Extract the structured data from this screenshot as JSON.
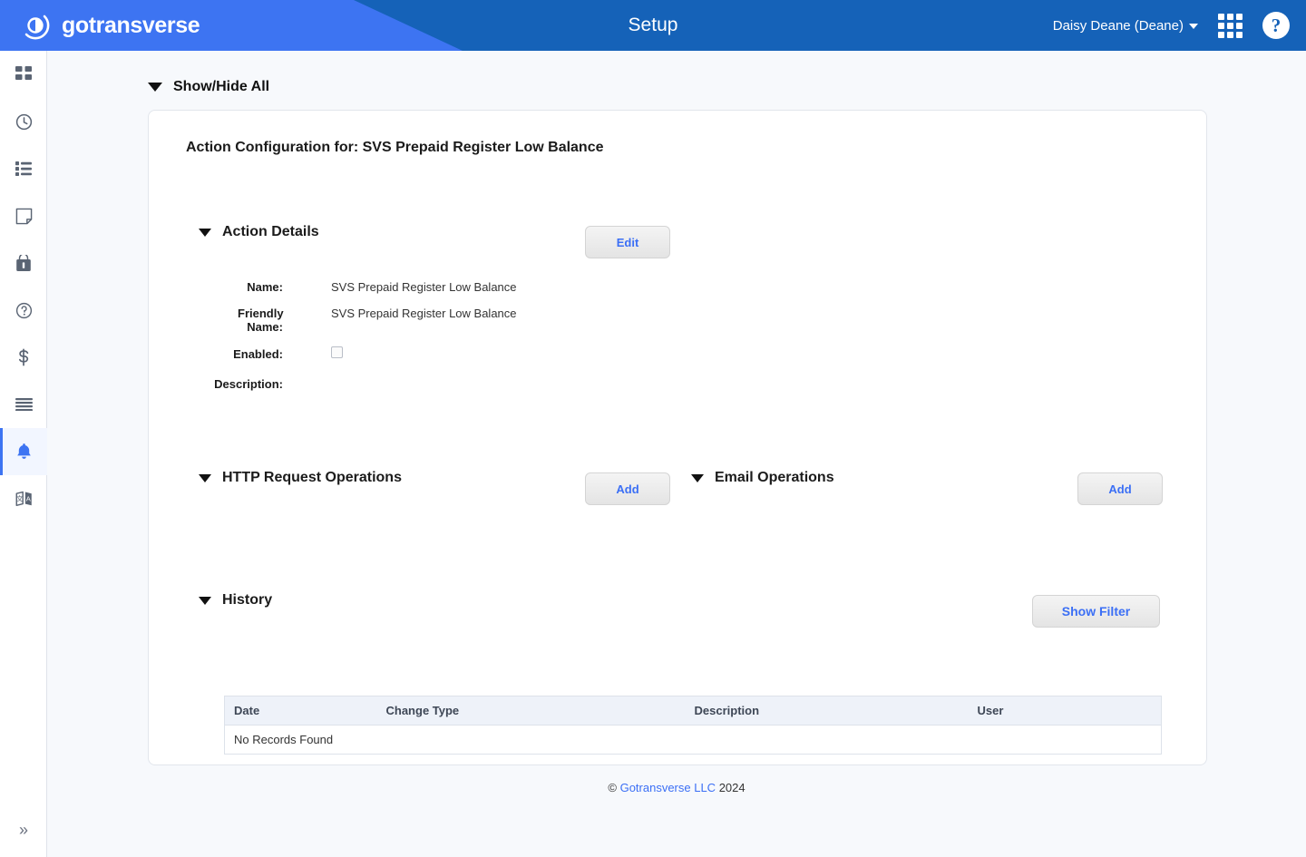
{
  "header": {
    "brand": "gotransverse",
    "brand_logo_icon": "gotransverse-circle-logo-icon",
    "title": "Setup",
    "user_name": "Daisy Deane (Deane)",
    "user_caret_icon": "caret-down-icon",
    "apps_icon": "apps-grid-icon",
    "help_icon": "help-question-icon",
    "color_light": "#3d74f2",
    "color_dark": "#1562b8"
  },
  "sidebar": {
    "items": [
      {
        "name": "dashboard",
        "icon": "dashboard-grid-icon",
        "active": false
      },
      {
        "name": "recent",
        "icon": "clock-icon",
        "active": false
      },
      {
        "name": "lists",
        "icon": "list-icon",
        "active": false
      },
      {
        "name": "documents",
        "icon": "document-icon",
        "active": false
      },
      {
        "name": "products",
        "icon": "bag-icon",
        "active": false
      },
      {
        "name": "support",
        "icon": "question-circle-icon",
        "active": false
      },
      {
        "name": "billing",
        "icon": "dollar-icon",
        "active": false
      },
      {
        "name": "menu",
        "icon": "hamburger-lines-icon",
        "active": false
      },
      {
        "name": "notifications",
        "icon": "bell-icon",
        "active": true
      },
      {
        "name": "language",
        "icon": "translate-icon",
        "active": false
      }
    ],
    "collapse_icon": "double-chevron-right-icon"
  },
  "main": {
    "show_hide_all": "Show/Hide All",
    "card_title": "Action Configuration for: SVS Prepaid Register Low Balance",
    "action_details": {
      "title": "Action Details",
      "edit_label": "Edit",
      "fields": [
        {
          "label": "Name:",
          "value": "SVS Prepaid Register Low Balance"
        },
        {
          "label": "Friendly Name:",
          "value": "SVS Prepaid Register Low Balance"
        },
        {
          "label": "Enabled:",
          "value": "",
          "type": "checkbox",
          "checked": false
        },
        {
          "label": "Description:",
          "value": ""
        }
      ]
    },
    "http_request_operations": {
      "title": "HTTP Request Operations",
      "add_label": "Add"
    },
    "email_operations": {
      "title": "Email Operations",
      "add_label": "Add"
    },
    "history": {
      "title": "History",
      "show_filter_label": "Show Filter",
      "columns": [
        "Date",
        "Change Type",
        "Description",
        "User"
      ],
      "empty_message": "No Records Found",
      "rows": []
    }
  },
  "footer": {
    "copyright_symbol": "©",
    "company": "Gotransverse LLC",
    "year": "2024"
  }
}
